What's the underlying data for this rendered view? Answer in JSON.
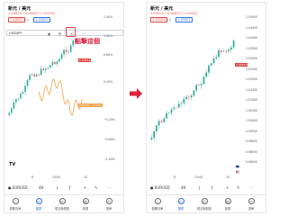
{
  "left": {
    "title": "新元 / 美元",
    "quote": "1.03513",
    "change": "−0.00437 (−0.41%)",
    "sell_price": "1.03507",
    "spread": "0.0",
    "buy_price": "1.03507",
    "indicator_name": "USD/JPY",
    "annotation": "點擊這個",
    "price_tag": "1.03513",
    "orange_tag": "USD/JPY −0.96%",
    "yticks": [
      "1.40%",
      "1.00%",
      "0.60%",
      "0.20%",
      "−0.20%",
      "−0.60%",
      "−1.00%"
    ],
    "xticks": [
      "8",
      "13:00",
      "15"
    ],
    "symbol": "EURUSD",
    "interval": "4H"
  },
  "right": {
    "title": "新元 / 美元",
    "quote": "1.03513",
    "change": "−0.00437 (−0.41%)",
    "sell_price": "1.03507",
    "spread": "0.0",
    "buy_price": "1.03507",
    "price_tag": "1.03513",
    "yticks": [
      "1.05000",
      "1.04500",
      "1.04000",
      "1.03500",
      "1.03000",
      "1.02500",
      "1.02000",
      "1.01500",
      "1.01000",
      "1.00500",
      "1.00000",
      "0.99500",
      "0.99000",
      "0.98500",
      "0.98000"
    ],
    "xticks": [
      "8",
      "13:00",
      "15"
    ],
    "symbol": "EURUSD",
    "interval": "4H"
  },
  "tabs": [
    {
      "label": "觀察清單",
      "icon": "star-icon"
    },
    {
      "label": "圖表",
      "icon": "chart-icon"
    },
    {
      "label": "想法與觀點",
      "icon": "idea-icon"
    },
    {
      "label": "新聞",
      "icon": "news-icon"
    },
    {
      "label": "選單",
      "icon": "menu-icon"
    }
  ],
  "colors": {
    "up": "#26a69a",
    "down": "#ef5350",
    "accent": "#2e6fe0",
    "orange": "#f0a046",
    "annotation": "#e0203a"
  }
}
